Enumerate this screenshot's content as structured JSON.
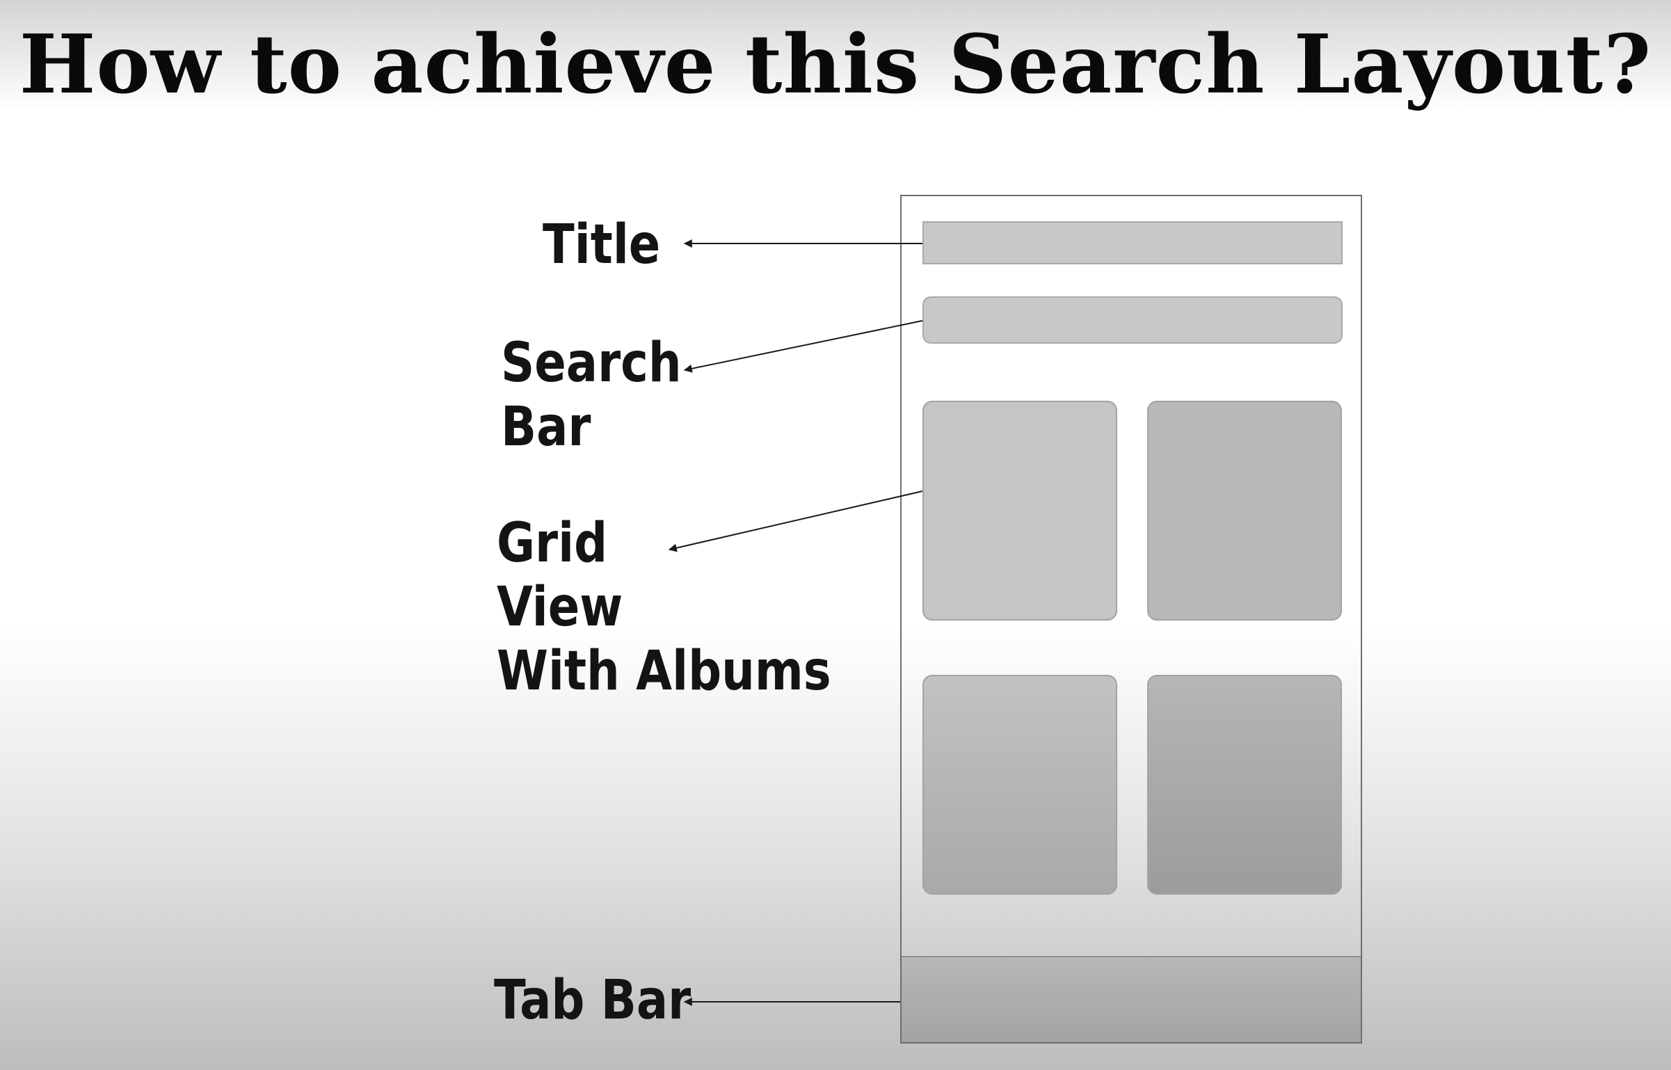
{
  "slide": {
    "title": "How to achieve this Search Layout?"
  },
  "labels": {
    "title": "Title",
    "search_bar": [
      "Search",
      "Bar"
    ],
    "grid_view": [
      "Grid",
      "View",
      "With Albums"
    ],
    "tab_bar": "Tab Bar"
  },
  "colors": {
    "wireframe_fill": "#c8c8c8",
    "wireframe_border": "#a9a9a9",
    "text": "#141414"
  }
}
